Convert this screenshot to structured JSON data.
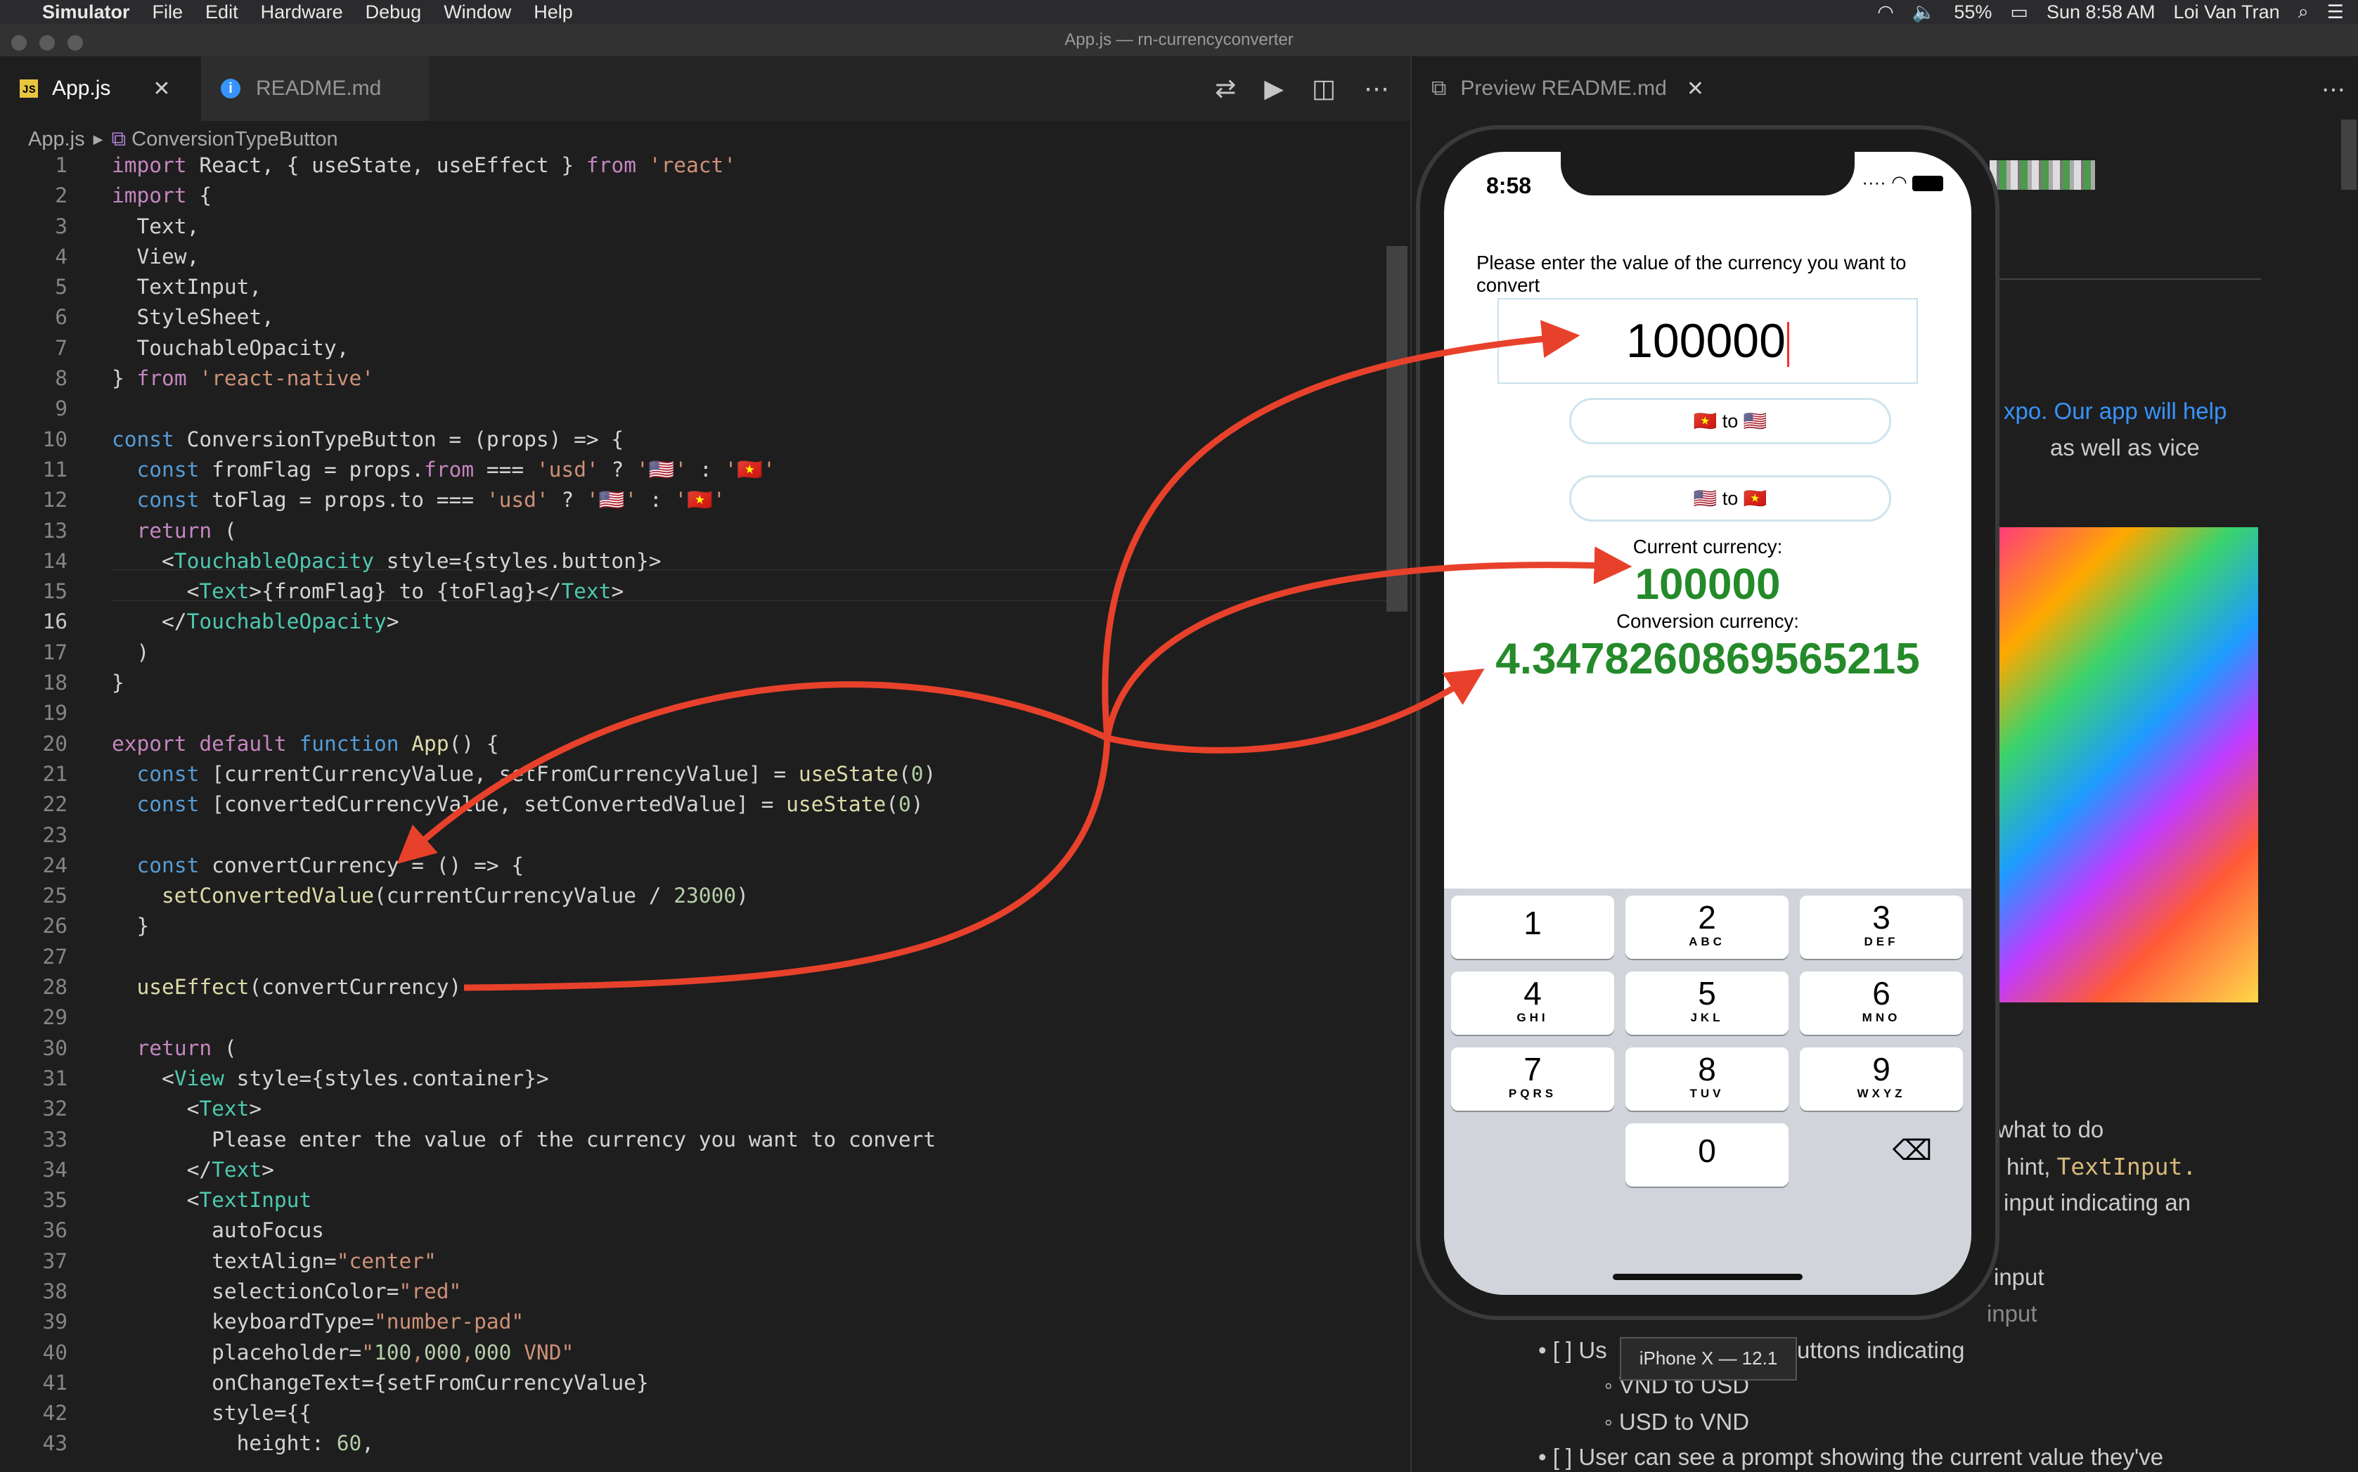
{
  "menubar": {
    "app": "Simulator",
    "items": [
      "File",
      "Edit",
      "Hardware",
      "Debug",
      "Window",
      "Help"
    ],
    "battery": "55%",
    "clock": "Sun 8:58 AM",
    "user": "Loi Van Tran"
  },
  "window_title": "App.js — rn-currencyconverter",
  "editor": {
    "tabs": [
      {
        "label": "App.js",
        "icon": "js-file-icon",
        "active": true
      },
      {
        "label": "README.md",
        "icon": "info-icon",
        "active": false
      }
    ],
    "breadcrumb": {
      "file": "App.js",
      "symbol": "ConversionTypeButton"
    },
    "current_line": 16,
    "lines": [
      "import React, { useState, useEffect } from 'react'",
      "import {",
      "  Text,",
      "  View,",
      "  TextInput,",
      "  StyleSheet,",
      "  TouchableOpacity,",
      "} from 'react-native'",
      "",
      "const ConversionTypeButton = (props) => {",
      "  const fromFlag = props.from === 'usd' ? '🇺🇸' : '🇻🇳'",
      "  const toFlag = props.to === 'usd' ? '🇺🇸' : '🇻🇳'",
      "  return (",
      "    <TouchableOpacity style={styles.button}>",
      "      <Text>{fromFlag} to {toFlag}</Text>",
      "    </TouchableOpacity>",
      "  )",
      "}",
      "",
      "export default function App() {",
      "  const [currentCurrencyValue, setFromCurrencyValue] = useState(0)",
      "  const [convertedCurrencyValue, setConvertedValue] = useState(0)",
      "",
      "  const convertCurrency = () => {",
      "    setConvertedValue(currentCurrencyValue / 23000)",
      "  }",
      "",
      "  useEffect(convertCurrency)",
      "",
      "  return (",
      "    <View style={styles.container}>",
      "      <Text>",
      "        Please enter the value of the currency you want to convert",
      "      </Text>",
      "      <TextInput",
      "        autoFocus",
      "        textAlign=\"center\"",
      "        selectionColor=\"red\"",
      "        keyboardType=\"number-pad\"",
      "        placeholder=\"100,000,000 VND\"",
      "        onChangeText={setFromCurrencyValue}",
      "        style={{",
      "          height: 60,"
    ]
  },
  "preview": {
    "tab_label": "Preview README.md",
    "fragments": [
      {
        "text": "xpo. Our app will help",
        "kind": "link-start"
      },
      {
        "text": "as well as vice",
        "kind": "plain"
      },
      {
        "text": "what to do",
        "kind": "plain"
      },
      {
        "text": "hint, ",
        "kind": "plain"
      },
      {
        "text": "TextInput.",
        "kind": "code"
      },
      {
        "text": "input indicating an",
        "kind": "plain"
      },
      {
        "text": "input",
        "kind": "plain"
      },
      {
        "text": "input",
        "kind": "plain"
      },
      {
        "text": "• [ ] Us",
        "kind": "plain"
      },
      {
        "text": "uttons indicating",
        "kind": "plain"
      },
      {
        "text": "◦ VND to USD",
        "kind": "plain"
      },
      {
        "text": "◦ USD to VND",
        "kind": "plain"
      },
      {
        "text": "• [ ] User can see a prompt showing the current value they've",
        "kind": "plain"
      }
    ]
  },
  "simulator": {
    "time": "8:58",
    "prompt": "Please enter the value of the currency you want to convert",
    "input_value": "100000",
    "buttons": [
      "🇻🇳 to 🇺🇸",
      "🇺🇸 to 🇻🇳"
    ],
    "current_label": "Current currency:",
    "current_value": "100000",
    "conversion_label": "Conversion currency:",
    "conversion_value": "4.3478260869565215",
    "keys": [
      {
        "d": "1",
        "l": ""
      },
      {
        "d": "2",
        "l": "ABC"
      },
      {
        "d": "3",
        "l": "DEF"
      },
      {
        "d": "4",
        "l": "GHI"
      },
      {
        "d": "5",
        "l": "JKL"
      },
      {
        "d": "6",
        "l": "MNO"
      },
      {
        "d": "7",
        "l": "PQRS"
      },
      {
        "d": "8",
        "l": "TUV"
      },
      {
        "d": "9",
        "l": "WXYZ"
      },
      {
        "d": "0",
        "l": ""
      }
    ],
    "device_tooltip": "iPhone X — 12.1"
  },
  "colors": {
    "annotation_arrow": "#e8412b",
    "green_value": "#258a2a"
  }
}
